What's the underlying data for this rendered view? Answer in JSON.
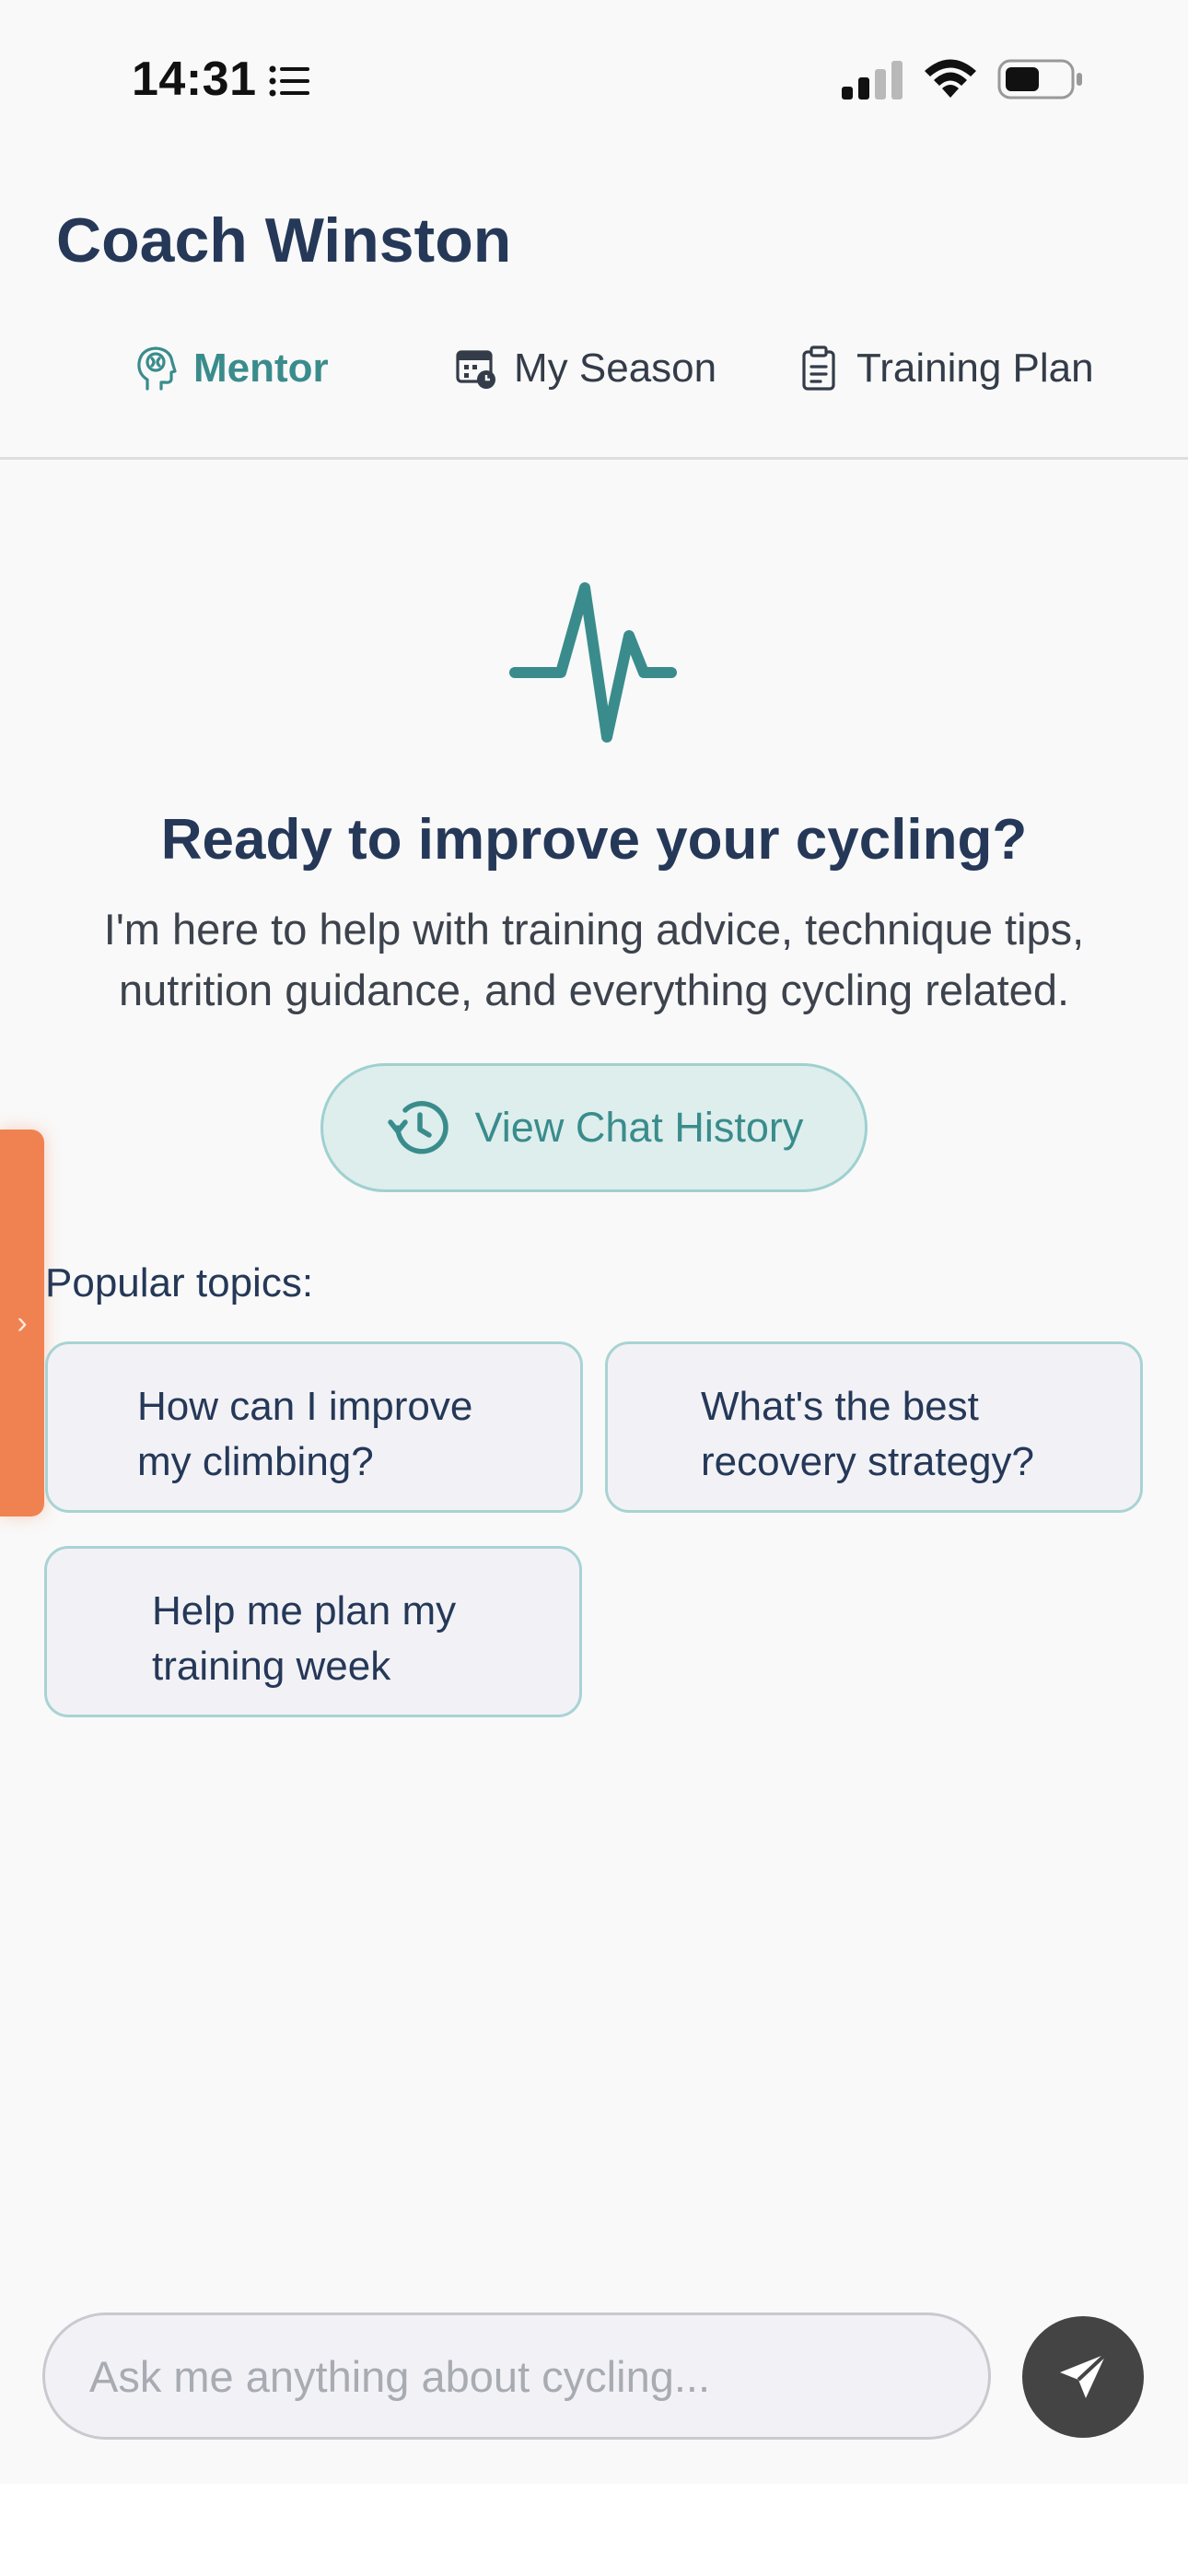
{
  "status_bar": {
    "time": "14:31",
    "icons": [
      "list-icon",
      "signal-icon",
      "wifi-icon",
      "battery-icon"
    ]
  },
  "header": {
    "title": "Coach Winston",
    "tabs": [
      {
        "label": "Mentor",
        "icon": "brain-head-icon",
        "active": true
      },
      {
        "label": "My Season",
        "icon": "calendar-clock-icon",
        "active": false
      },
      {
        "label": "Training Plan",
        "icon": "clipboard-icon",
        "active": false
      }
    ]
  },
  "hero": {
    "icon": "pulse-icon",
    "title": "Ready to improve your cycling?",
    "description_line1": "I'm here to help with training advice, technique tips,",
    "description_line2": "nutrition guidance, and everything cycling related.",
    "history_button": "View Chat History"
  },
  "side_tab": {
    "glyph": "›"
  },
  "topics": {
    "label": "Popular topics:",
    "items": [
      {
        "line1": "How can I improve",
        "line2": "my climbing?"
      },
      {
        "line1": "What's the best",
        "line2": "recovery strategy?"
      },
      {
        "line1": "Help me plan my",
        "line2": "training week"
      }
    ]
  },
  "composer": {
    "placeholder": "Ask me anything about cycling...",
    "send_icon": "send-icon"
  },
  "colors": {
    "accent": "#3a8c8c",
    "title": "#253858",
    "side_tab": "#f08251",
    "send_button": "#444444"
  }
}
